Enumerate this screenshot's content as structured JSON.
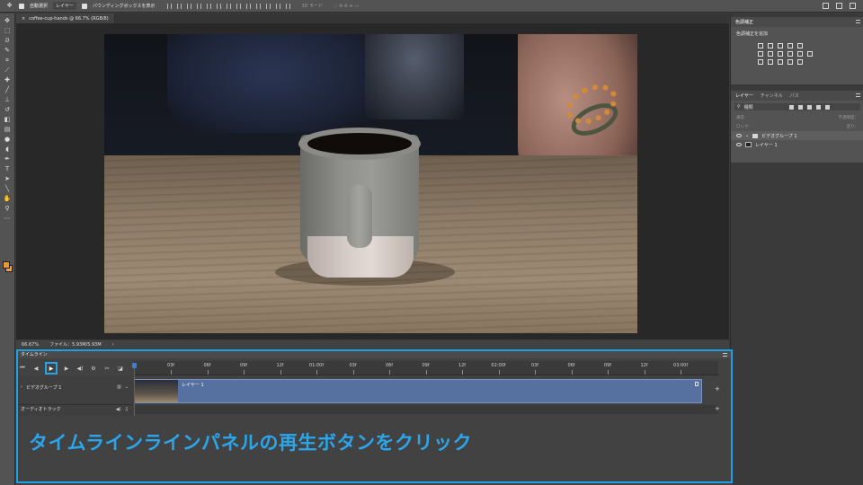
{
  "options_bar": {
    "auto_select_label": "自動選択",
    "layer_select_value": "レイヤー",
    "bounding_box_label": "バウンディングボックスを表示",
    "mode_3d_label": "3D モード"
  },
  "document_tab": {
    "title": "coffee-cup-hands @ 66.7% (RGB/8)"
  },
  "status_bar": {
    "zoom": "66.67%",
    "file_info": "ファイル：5.93M/5.93M"
  },
  "adjustments_panel": {
    "title": "色調補正",
    "add_label": "色調補正を追加"
  },
  "layers_panel": {
    "tabs": [
      "レイヤー",
      "チャンネル",
      "パス"
    ],
    "filter_label": "種類",
    "blend_mode": "通常",
    "opacity_label": "不透明度：",
    "lock_label": "ロック：",
    "fill_label": "塗り：",
    "layers": [
      {
        "name": "ビデオグループ 1",
        "type": "group"
      },
      {
        "name": "レイヤー 1",
        "type": "layer"
      }
    ]
  },
  "timeline": {
    "title": "タイムライン",
    "ruler_labels": [
      "03f",
      "06f",
      "09f",
      "12f",
      "01:00f",
      "03f",
      "06f",
      "09f",
      "12f",
      "02:00f",
      "03f",
      "06f",
      "09f",
      "12f",
      "03:00f"
    ],
    "tracks": {
      "video_group": "ビデオグループ 1",
      "audio": "オーディオトラック"
    },
    "clip_label": "レイヤー 1"
  },
  "instruction": "タイムラインラインパネルの再生ボタンをクリック",
  "colors": {
    "accent": "#1ea0e6",
    "clip": "#56709f",
    "foreground_swatch": "#e69a3a"
  }
}
